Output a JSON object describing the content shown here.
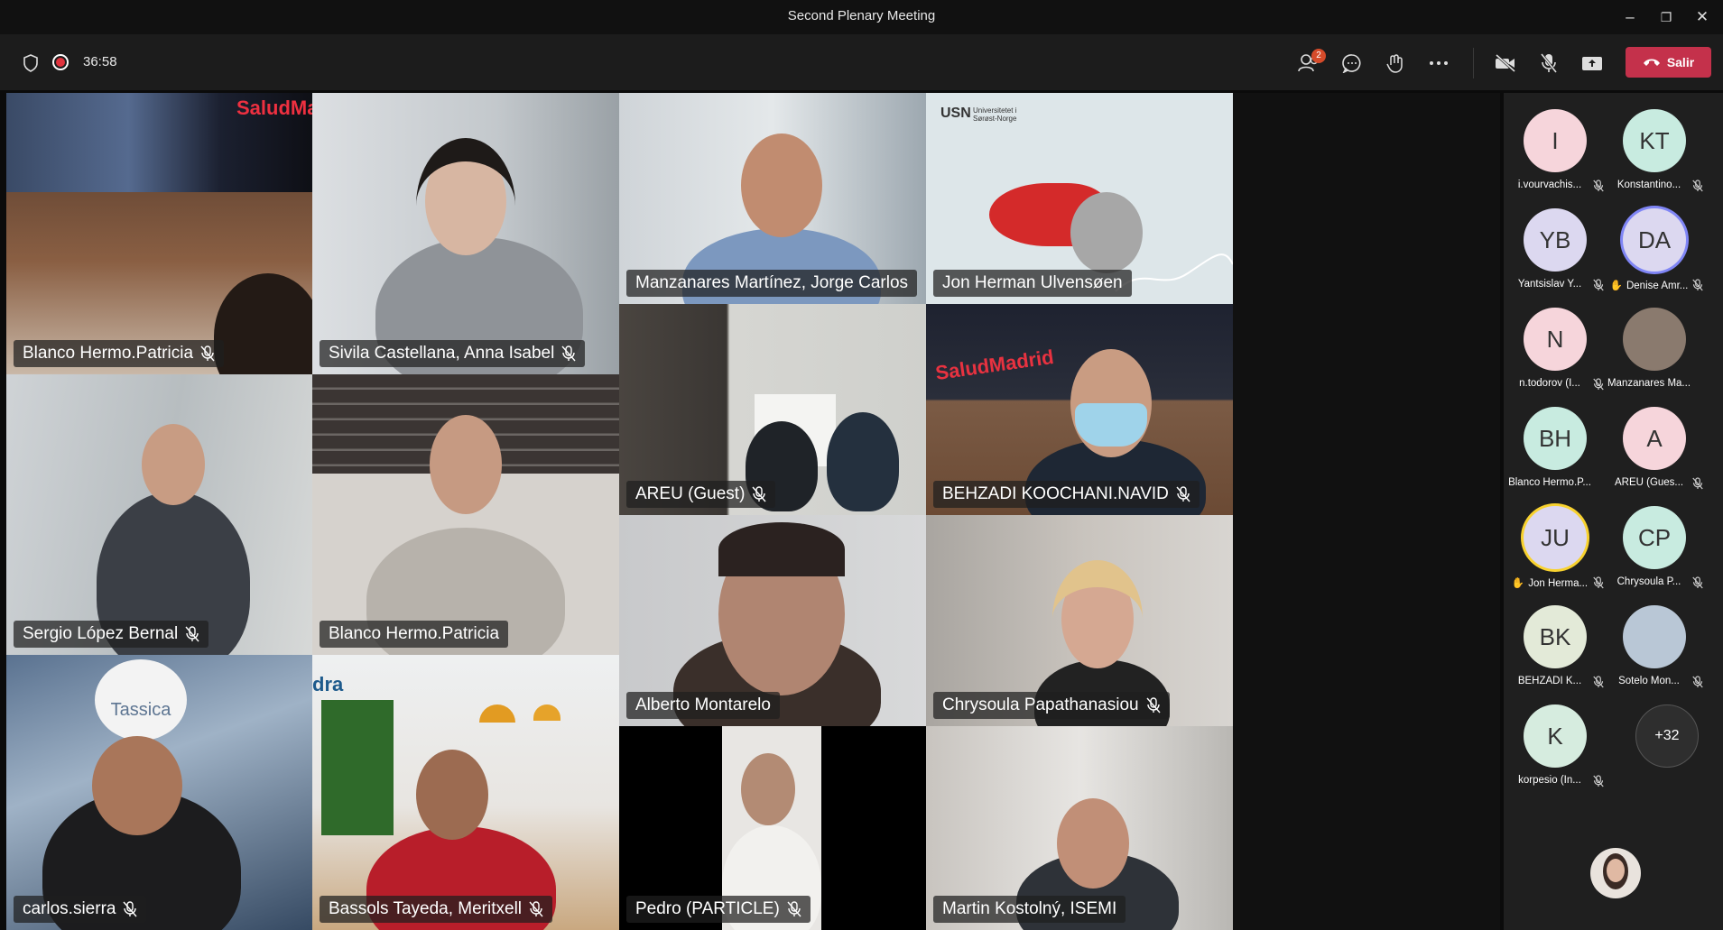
{
  "window": {
    "title": "Second Plenary Meeting",
    "controls": [
      "–",
      "❐",
      "✕"
    ]
  },
  "toolbar": {
    "timer": "36:58",
    "participants_badge": "2",
    "leave_label": "Salir",
    "leave_color": "#c4314b"
  },
  "tiles": [
    {
      "name": "Blanco Hermo.Patricia",
      "muted": true
    },
    {
      "name": "Sivila Castellana, Anna Isabel",
      "muted": true
    },
    {
      "name": "Manzanares Martínez, Jorge Carlos",
      "muted": false
    },
    {
      "name": "Jon Herman Ulvensøen",
      "muted": false
    },
    {
      "name": "AREU (Guest)",
      "muted": true
    },
    {
      "name": "BEHZADI KOOCHANI.NAVID",
      "muted": true
    },
    {
      "name": "Sergio López Bernal",
      "muted": true
    },
    {
      "name": "Blanco Hermo.Patricia",
      "muted": false
    },
    {
      "name": "Alberto Montarelo",
      "muted": false
    },
    {
      "name": "Chrysoula Papathanasiou",
      "muted": true
    },
    {
      "name": "carlos.sierra",
      "muted": true
    },
    {
      "name": "Bassols Tayeda, Meritxell",
      "muted": true
    },
    {
      "name": "Pedro (PARTICLE)",
      "muted": true
    },
    {
      "name": "Martin Kostolný, ISEMI",
      "muted": false
    }
  ],
  "branding": {
    "saludmadrid": "SaludMadrid",
    "tassica": "Tassica",
    "usn": "USN",
    "usn_sub": "Universitetet i Sørøst-Norge",
    "dra": "dra"
  },
  "panel": {
    "participants": [
      {
        "initials": "I",
        "name": "i.vourvachis...",
        "color": "#f6d5db"
      },
      {
        "initials": "KT",
        "name": "Konstantino...",
        "color": "#c8ebe0"
      },
      {
        "initials": "YB",
        "name": "Yantsislav Y...",
        "color": "#dcd8f0"
      },
      {
        "initials": "DA",
        "name": "Denise Amr...",
        "color": "#dcd8f0",
        "hand": "✋"
      },
      {
        "initials": "N",
        "name": "n.todorov (I...",
        "color": "#f6d5db"
      },
      {
        "initials": "",
        "name": "Manzanares Ma...",
        "color": "#8a7a6e"
      },
      {
        "initials": "BH",
        "name": "Blanco Hermo.P...",
        "color": "#c8ebe0"
      },
      {
        "initials": "A",
        "name": "AREU (Gues...",
        "color": "#f6d5db"
      },
      {
        "initials": "JU",
        "name": "Jon Herma...",
        "color": "#dcd8f0",
        "hand": "✋"
      },
      {
        "initials": "CP",
        "name": "Chrysoula P...",
        "color": "#c8ebe0"
      },
      {
        "initials": "BK",
        "name": "BEHZADI K...",
        "color": "#e3ead8"
      },
      {
        "initials": "",
        "name": "Sotelo Mon...",
        "color": "#b9c7d6"
      },
      {
        "initials": "K",
        "name": "korpesio (In...",
        "color": "#d6ecdf"
      }
    ],
    "more": "+32"
  }
}
